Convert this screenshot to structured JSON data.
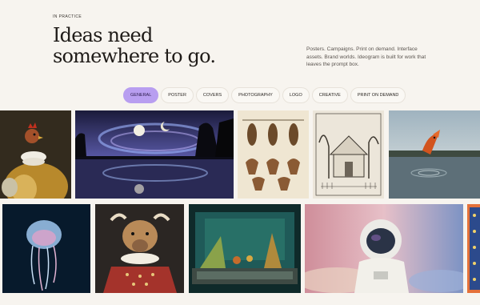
{
  "section": {
    "eyebrow": "IN PRACTICE",
    "headline_line1": "Ideas need",
    "headline_line2": "somewhere to go.",
    "blurb": "Posters. Campaigns. Print on demand. Interface assets. Brand worlds. Ideogram is built for work that leaves the prompt box."
  },
  "filters": [
    {
      "label": "GENERAL",
      "active": true
    },
    {
      "label": "POSTER",
      "active": false
    },
    {
      "label": "COVERS",
      "active": false
    },
    {
      "label": "PHOTOGRAPHY",
      "active": false
    },
    {
      "label": "LOGO",
      "active": false
    },
    {
      "label": "CREATIVE",
      "active": false
    },
    {
      "label": "PRINT ON DEMAND",
      "active": false
    }
  ],
  "gallery": {
    "row1": [
      {
        "subject": "rooster-portrait-painting"
      },
      {
        "subject": "moonlit-lake-landscape"
      },
      {
        "subject": "bat-specimen-illustration"
      },
      {
        "subject": "house-sketch-drawing"
      },
      {
        "subject": "leaping-koi-fish-photo"
      }
    ],
    "row2": [
      {
        "subject": "jellyfish-photo"
      },
      {
        "subject": "highland-cow-portrait"
      },
      {
        "subject": "aquarium-diorama"
      },
      {
        "subject": "astronaut-portrait"
      },
      {
        "subject": "ornamental-pattern-edge"
      }
    ]
  }
}
